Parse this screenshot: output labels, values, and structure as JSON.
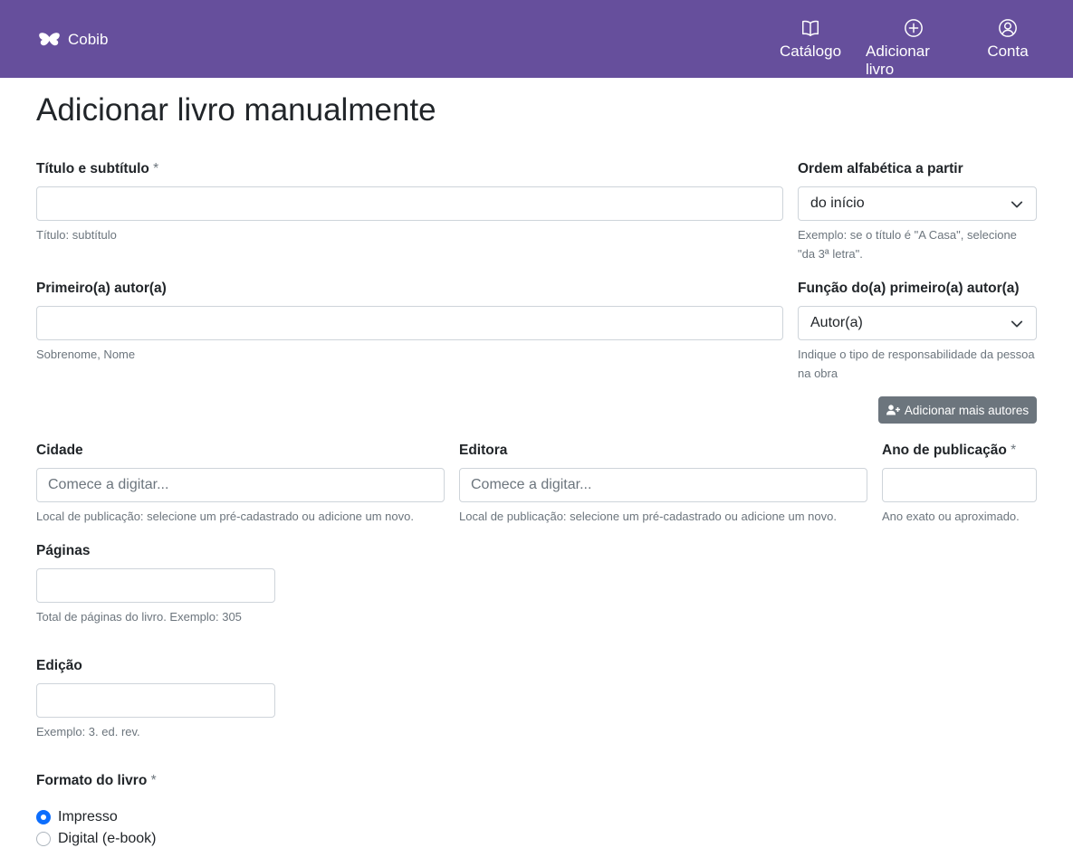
{
  "navbar": {
    "brand": "Cobib",
    "items": [
      {
        "label": "Catálogo",
        "icon": "book-icon"
      },
      {
        "label": "Adicionar livro",
        "icon": "plus-circle-icon"
      },
      {
        "label": "Conta",
        "icon": "user-circle-icon"
      }
    ],
    "color": "#664f9c"
  },
  "page": {
    "title": "Adicionar livro manualmente"
  },
  "form": {
    "required_marker": "*",
    "title": {
      "label": "Título e subtítulo",
      "value": "",
      "help": "Título: subtítulo"
    },
    "alpha_order": {
      "label": "Ordem alfabética a partir",
      "selected": "do início",
      "help": "Exemplo: se o título é \"A Casa\", selecione \"da 3ª letra\"."
    },
    "first_author": {
      "label": "Primeiro(a) autor(a)",
      "value": "",
      "help": "Sobrenome, Nome"
    },
    "author_role": {
      "label": "Função do(a) primeiro(a) autor(a)",
      "selected": "Autor(a)",
      "help": "Indique o tipo de responsabilidade da pessoa na obra"
    },
    "add_authors_button": "Adicionar mais autores",
    "city": {
      "label": "Cidade",
      "placeholder": "Comece a digitar...",
      "help": "Local de publicação: selecione um pré-cadastrado ou adicione um novo."
    },
    "publisher": {
      "label": "Editora",
      "placeholder": "Comece a digitar...",
      "help": "Local de publicação: selecione um pré-cadastrado ou adicione um novo."
    },
    "year": {
      "label": "Ano de publicação",
      "value": "",
      "help": "Ano exato ou aproximado."
    },
    "pages": {
      "label": "Páginas",
      "value": "",
      "help": "Total de páginas do livro. Exemplo: 305"
    },
    "edition": {
      "label": "Edição",
      "value": "",
      "help": "Exemplo: 3. ed. rev."
    },
    "format": {
      "label": "Formato do livro",
      "options": [
        {
          "label": "Impresso",
          "checked": true
        },
        {
          "label": "Digital (e-book)",
          "checked": false
        }
      ]
    }
  }
}
